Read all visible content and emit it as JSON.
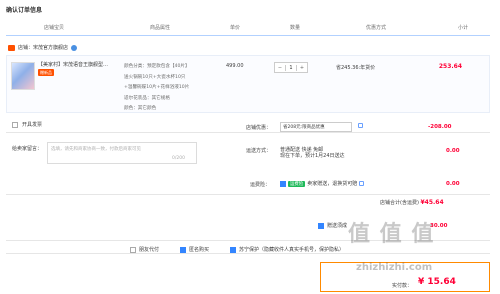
{
  "page": {
    "title": "确认订单信息"
  },
  "columns": [
    "店铺宝贝",
    "商品属性",
    "单价",
    "数量",
    "优惠方式",
    "小计"
  ],
  "store": {
    "name": "店铺：宋茂官方旗舰店"
  },
  "item": {
    "title": "【美家村】宋茂语音王旗舰型…",
    "tag": "赠新品",
    "attrs": [
      "颜色分类：预定款包含【40片】",
      "送火锅碗10只+大瓷水杯10只",
      "+温馨碗碟10片+花样浴液10片",
      "适尔花装品：其它规格",
      "颜色：其它颜色"
    ],
    "price": "499.00",
    "qty": "1",
    "qty_minus": "−",
    "qty_plus": "+",
    "promo": "省245.36:年货价",
    "subtotal": "253.64"
  },
  "invoice": {
    "label": "开具发票"
  },
  "message": {
    "label": "给卖家留言：",
    "placeholder": "选填，请先和商家协商一致，付款后商家可见",
    "count": "0/200"
  },
  "coupon": {
    "label": "店铺优惠：",
    "value": "省208元:限商品优惠",
    "amount": "-208.00"
  },
  "shipping": {
    "label": "运送方式：",
    "line1": "普通配送 快递 免邮",
    "line2": "现在下单，预计1月24日送达",
    "amount": "0.00"
  },
  "insurance": {
    "label": "运费险：",
    "tag": "运费险",
    "text": "卖家赠送，退换货可赔",
    "amount": "0.00"
  },
  "store_total": {
    "label": "店铺合计(含运费)",
    "amount": "¥45.64"
  },
  "gift": {
    "label": "赠送须成",
    "amount": "30.00"
  },
  "options": [
    {
      "label": "朋友代付",
      "checked": false
    },
    {
      "label": "匿名购买",
      "checked": true
    },
    {
      "label": "苏宁保护（隐藏收件人真实手机号，保护隐私）",
      "checked": true
    }
  ],
  "payment": {
    "label": "实付款：",
    "amount": "¥ 15.64"
  },
  "watermark": {
    "main": "值 值 值",
    "sub": "zhizhizhi.com"
  }
}
